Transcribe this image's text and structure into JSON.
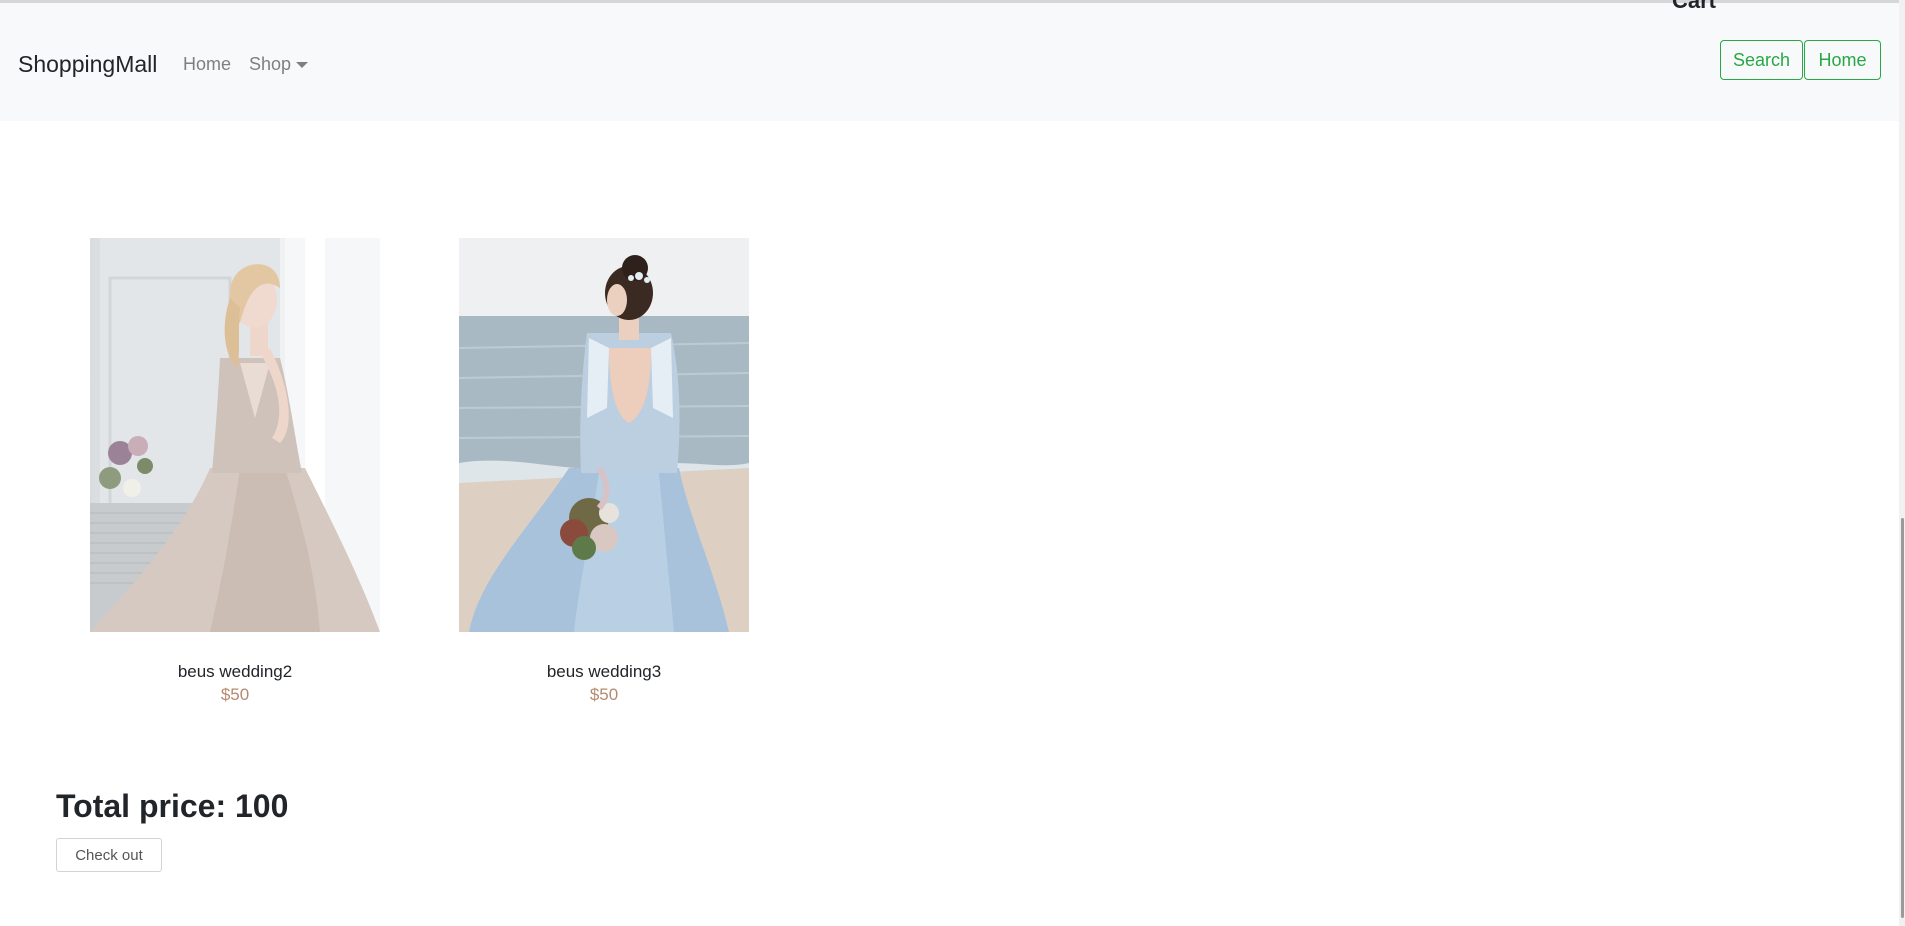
{
  "navbar": {
    "brand": "ShoppingMall",
    "links": {
      "home": "Home",
      "shop": "Shop"
    },
    "cart_heading_partial": "Cart",
    "search_button": "Search",
    "home_button": "Home",
    "accent_color": "#28a745"
  },
  "cart": {
    "items": [
      {
        "name": "beus wedding2",
        "price": "$50",
        "image": "bride-in-beige-gown-by-window"
      },
      {
        "name": "beus wedding3",
        "price": "$50",
        "image": "bride-in-blue-gown-on-beach"
      }
    ],
    "total_label": "Total price: 100",
    "checkout_button": "Check out",
    "price_color": "#b48a6e"
  },
  "icons": {
    "shop_caret": "caret-down-icon"
  }
}
